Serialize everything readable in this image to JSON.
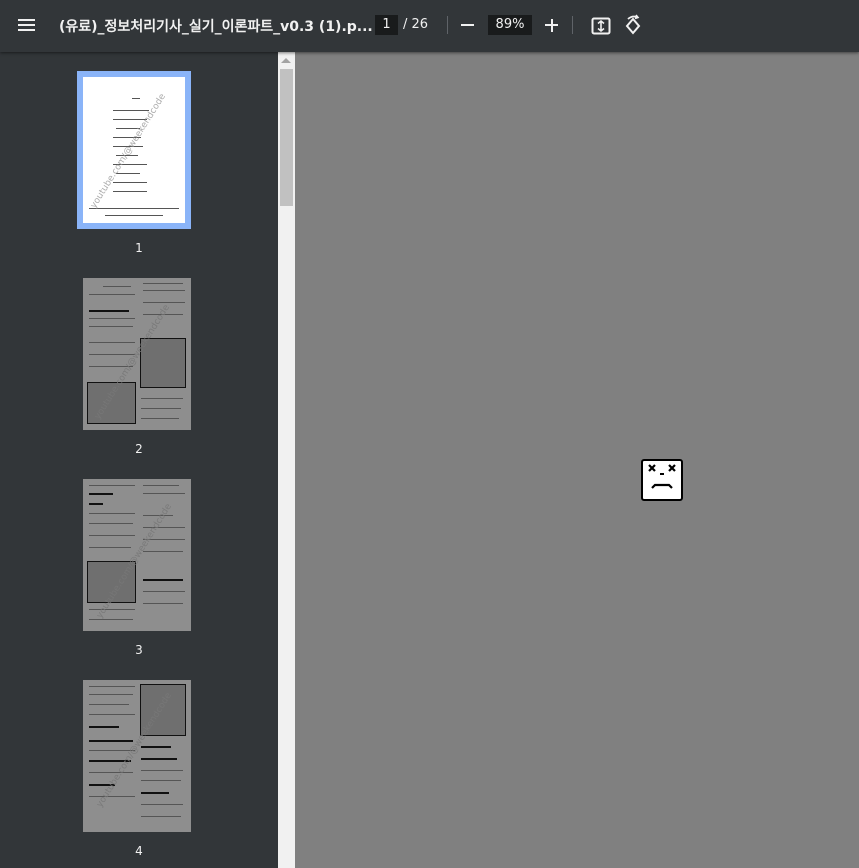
{
  "toolbar": {
    "title": "(유료)_정보처리기사_실기_이론파트_v0.3 (1).p...",
    "page_current": "1",
    "page_total": "/ 26",
    "zoom": "89%",
    "icons": [
      "menu-icon",
      "minus-icon",
      "plus-icon",
      "fit-to-page-icon",
      "rotate-icon"
    ]
  },
  "sidebar": {
    "thumbnails": [
      {
        "label": "1",
        "selected": true
      },
      {
        "label": "2",
        "selected": false
      },
      {
        "label": "3",
        "selected": false
      },
      {
        "label": "4",
        "selected": false
      }
    ],
    "watermark": "youtube.com/@weekendcode"
  },
  "viewer": {
    "status_icon": "sad-face-broken-page-icon"
  },
  "colors": {
    "toolbar_bg": "#323639",
    "viewer_bg": "#808080",
    "selected_border": "#8ab4f8"
  }
}
